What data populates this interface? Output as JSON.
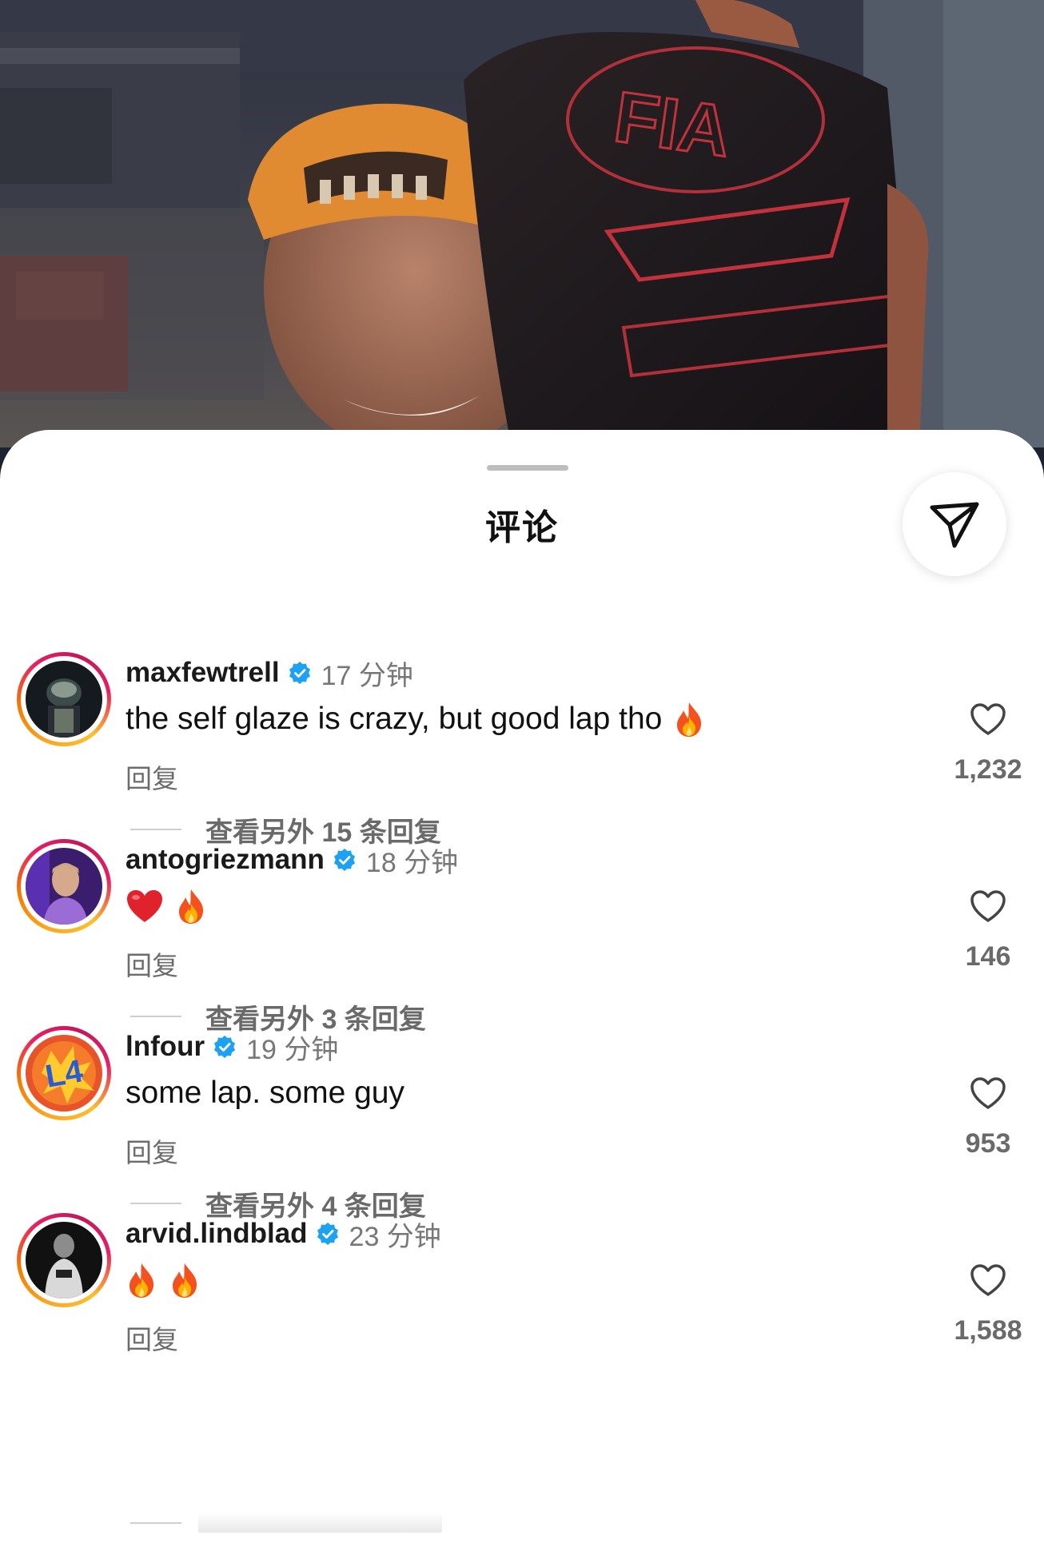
{
  "sheet": {
    "title": "评论",
    "share_icon": "send-icon"
  },
  "colors": {
    "verified": "#1da1f2",
    "secondary_text": "#6a6a6a",
    "ring": "#e91e63"
  },
  "comments": [
    {
      "username": "maxfewtrell",
      "verified": true,
      "time": "17 分钟",
      "text": "the self glaze is crazy, but good lap tho",
      "emojis": [
        "fire-emoji"
      ],
      "reply_label": "回复",
      "more_replies": "查看另外 15 条回复",
      "likes": "1,232"
    },
    {
      "username": "antogriezmann",
      "verified": true,
      "time": "18 分钟",
      "text": "",
      "emojis": [
        "red-heart-emoji",
        "fire-emoji"
      ],
      "reply_label": "回复",
      "more_replies": "查看另外 3 条回复",
      "likes": "146"
    },
    {
      "username": "lnfour",
      "verified": true,
      "time": "19 分钟",
      "text": "some lap. some guy",
      "emojis": [],
      "reply_label": "回复",
      "more_replies": "查看另外 4 条回复",
      "likes": "953"
    },
    {
      "username": "arvid.lindblad",
      "verified": true,
      "time": "23 分钟",
      "text": "",
      "emojis": [
        "fire-emoji",
        "fire-emoji"
      ],
      "reply_label": "回复",
      "more_replies": "",
      "likes": "1,588"
    }
  ]
}
